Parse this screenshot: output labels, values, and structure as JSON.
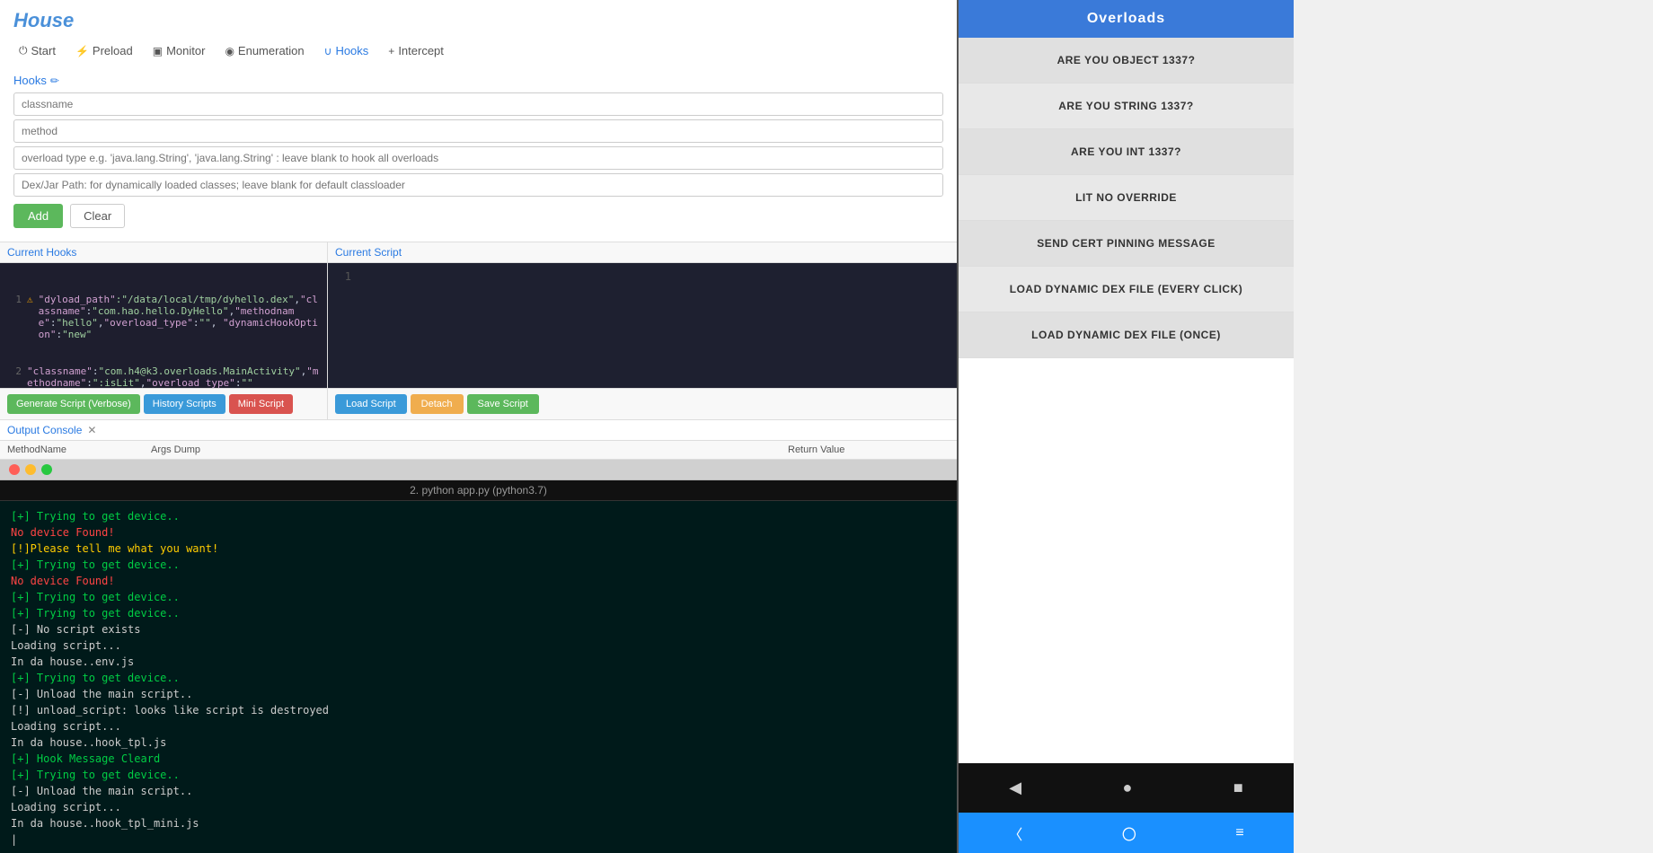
{
  "app": {
    "title": "House"
  },
  "nav": {
    "tabs": [
      {
        "id": "start",
        "icon": "⏻",
        "label": "Start"
      },
      {
        "id": "preload",
        "icon": "⚡",
        "label": "Preload"
      },
      {
        "id": "monitor",
        "icon": "▣",
        "label": "Monitor"
      },
      {
        "id": "enumeration",
        "icon": "◉",
        "label": "Enumeration"
      },
      {
        "id": "hooks",
        "icon": "∪",
        "label": "Hooks",
        "active": true
      },
      {
        "id": "intercept",
        "icon": "+",
        "label": "Intercept"
      }
    ]
  },
  "hooks": {
    "label": "Hooks",
    "fields": {
      "classname": {
        "placeholder": "classname"
      },
      "method": {
        "placeholder": "method"
      },
      "overload": {
        "placeholder": "overload type e.g. 'java.lang.String', 'java.lang.String' : leave blank to hook all overloads"
      },
      "dex": {
        "placeholder": "Dex/Jar Path: for dynamically loaded classes; leave blank for default classloader"
      }
    },
    "buttons": {
      "add": "Add",
      "clear": "Clear"
    }
  },
  "current_hooks": {
    "label": "Current Hooks",
    "content": "{\n  \"dyload_path\":\"/data/local/tmp/dyhello.dex\",\"classname\":\"com\n  .hao.hello.DyHello\",\"methodname\":\"hello\",\"overload_type\"\n  :\"\",\"dynamicHookOption\":\"new\"\n}\n{\n  \"classname\":\"com.h4@k3.overloads.MainActivity\",\"methodname\"\n  :\":isLit\",\"overload_type\":\"\"\n}\n",
    "buttons": {
      "generate": "Generate Script (Verbose)",
      "history": "History Scripts",
      "mini": "Mini Script"
    }
  },
  "current_script": {
    "label": "Current Script",
    "line_num": "1",
    "buttons": {
      "load": "Load Script",
      "detach": "Detach",
      "save": "Save Script"
    }
  },
  "output_console": {
    "label": "Output Console",
    "columns": {
      "method": "MethodName",
      "args": "Args Dump",
      "return": "Return Value"
    }
  },
  "terminal": {
    "title": "2. python app.py (python3.7)",
    "lines": [
      {
        "type": "green",
        "text": "[+] Trying to get device.."
      },
      {
        "type": "red",
        "text": "No device Found!"
      },
      {
        "type": "yellow",
        "text": "[!]Please tell me what you want!"
      },
      {
        "type": "green",
        "text": "[+] Trying to get device.."
      },
      {
        "type": "red",
        "text": "No device Found!"
      },
      {
        "type": "green",
        "text": "[+] Trying to get device.."
      },
      {
        "type": "green",
        "text": "[+] Trying to get device.."
      },
      {
        "type": "white",
        "text": "[-] No script exists"
      },
      {
        "type": "white",
        "text": "Loading script..."
      },
      {
        "type": "white",
        "text": "In da house..env.js"
      },
      {
        "type": "green",
        "text": "[+] Trying to get device.."
      },
      {
        "type": "white",
        "text": "[-] Unload the main script.."
      },
      {
        "type": "white",
        "text": "[!] unload_script: looks like script is destroyed"
      },
      {
        "type": "white",
        "text": "Loading script..."
      },
      {
        "type": "white",
        "text": "In da house..hook_tpl.js"
      },
      {
        "type": "green",
        "text": "[+] Hook Message Cleard"
      },
      {
        "type": "green",
        "text": "[+] Trying to get device.."
      },
      {
        "type": "white",
        "text": "[-] Unload the main script.."
      },
      {
        "type": "white",
        "text": "Loading script..."
      },
      {
        "type": "white",
        "text": "In da house..hook_tpl_mini.js"
      }
    ]
  },
  "device": {
    "header": "Overloads",
    "overloads": [
      {
        "label": "ARE YOU OBJECT 1337?"
      },
      {
        "label": "ARE YOU STRING 1337?"
      },
      {
        "label": "ARE YOU INT 1337?"
      },
      {
        "label": "LIT NO OVERRIDE"
      },
      {
        "label": "SEND CERT PINNING MESSAGE"
      },
      {
        "label": "LOAD DYNAMIC DEX FILE (EVERY CLICK)"
      },
      {
        "label": "LOAD DYNAMIC DEX FILE (ONCE)"
      }
    ],
    "nav": {
      "back": "◀",
      "home": "●",
      "recent": "■"
    },
    "bottom": {
      "back": "〈",
      "home": "〇",
      "menu": "≡"
    }
  }
}
